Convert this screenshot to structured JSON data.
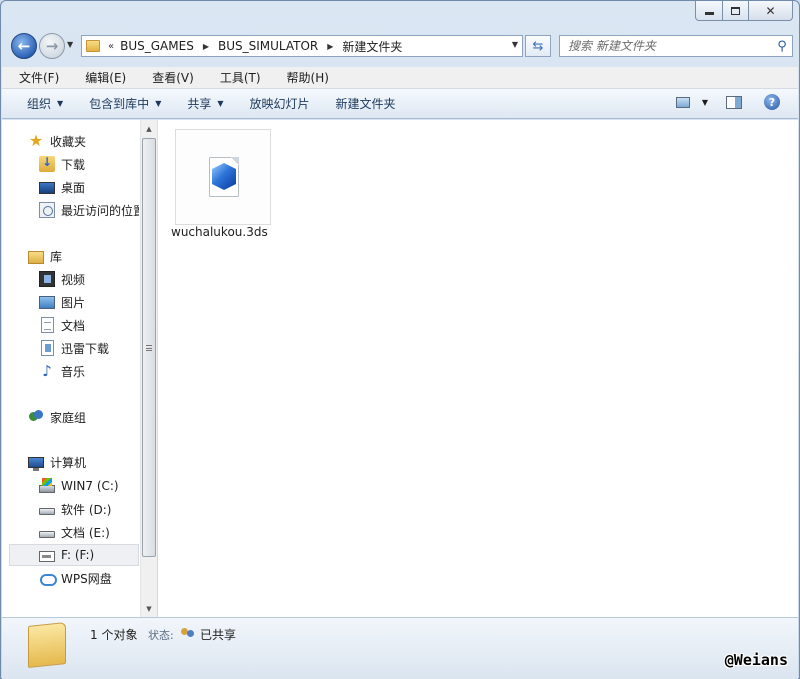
{
  "address": {
    "overflow_glyph": "«",
    "crumbs": [
      "BUS_GAMES",
      "BUS_SIMULATOR",
      "新建文件夹"
    ]
  },
  "search": {
    "placeholder": "搜索 新建文件夹"
  },
  "menubar": {
    "items": [
      "文件(F)",
      "编辑(E)",
      "查看(V)",
      "工具(T)",
      "帮助(H)"
    ]
  },
  "toolbar": {
    "organize": "组织",
    "include_in_library": "包含到库中",
    "share": "共享",
    "slideshow": "放映幻灯片",
    "new_folder": "新建文件夹"
  },
  "navpane": {
    "favorites": "收藏夹",
    "downloads": "下载",
    "desktop": "桌面",
    "recent": "最近访问的位置",
    "libraries": "库",
    "videos": "视频",
    "pictures": "图片",
    "documents": "文档",
    "thunder": "迅雷下载",
    "music": "音乐",
    "homegroup": "家庭组",
    "computer": "计算机",
    "drive_c": "WIN7 (C:)",
    "drive_d": "软件 (D:)",
    "drive_e": "文档 (E:)",
    "drive_f": "F: (F:)",
    "wps": "WPS网盘"
  },
  "content": {
    "files": [
      {
        "name": "wuchalukou.3ds",
        "icon": "3ds-file-icon"
      }
    ]
  },
  "details": {
    "count": "1 个对象",
    "status_label": "状态:",
    "status_value": "已共享"
  },
  "watermark": "@Weians"
}
